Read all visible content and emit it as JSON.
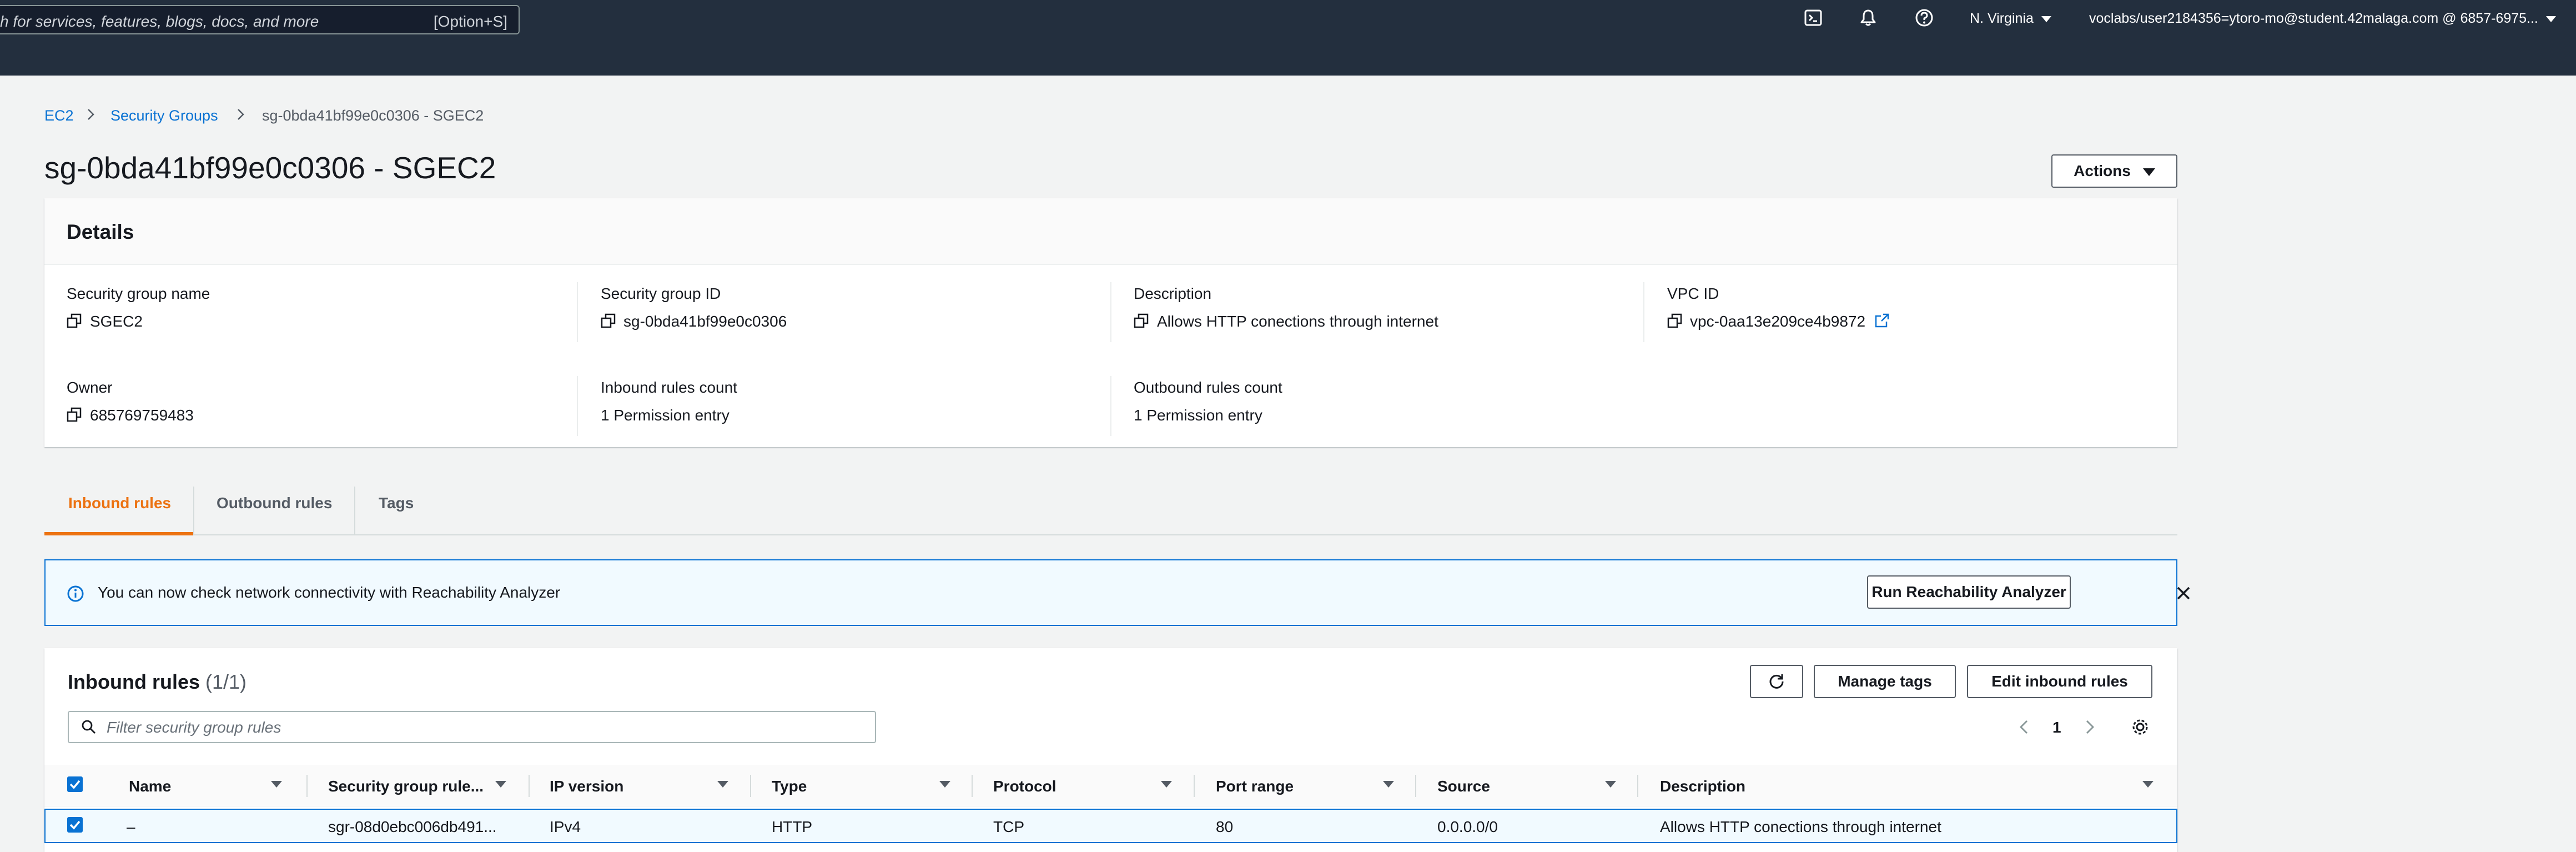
{
  "topnav": {
    "search_placeholder": "h for services, features, blogs, docs, and more",
    "search_shortcut": "[Option+S]",
    "region": "N. Virginia",
    "account": "voclabs/user2184356=ytoro-mo@student.42malaga.com @ 6857-6975..."
  },
  "breadcrumb": [
    "EC2",
    "Security Groups",
    "sg-0bda41bf99e0c0306 - SGEC2"
  ],
  "page_title": "sg-0bda41bf99e0c0306 - SGEC2",
  "actions_label": "Actions",
  "details": {
    "title": "Details",
    "fields": [
      {
        "label": "Security group name",
        "value": "SGEC2"
      },
      {
        "label": "Security group ID",
        "value": "sg-0bda41bf99e0c0306"
      },
      {
        "label": "Description",
        "value": "Allows HTTP conections through internet"
      },
      {
        "label": "VPC ID",
        "value": "vpc-0aa13e209ce4b9872"
      },
      {
        "label": "Owner",
        "value": "685769759483"
      },
      {
        "label": "Inbound rules count",
        "value": "1 Permission entry"
      },
      {
        "label": "Outbound rules count",
        "value": "1 Permission entry"
      }
    ]
  },
  "tabs": [
    "Inbound rules",
    "Outbound rules",
    "Tags"
  ],
  "banner": {
    "text": "You can now check network connectivity with Reachability Analyzer",
    "button": "Run Reachability Analyzer"
  },
  "rules": {
    "title": "Inbound rules",
    "count": "(1/1)",
    "manage_tags": "Manage tags",
    "edit_rules": "Edit inbound rules",
    "filter_placeholder": "Filter security group rules",
    "page": "1",
    "columns": [
      "Name",
      "Security group rule...",
      "IP version",
      "Type",
      "Protocol",
      "Port range",
      "Source",
      "Description"
    ],
    "rows": [
      {
        "name": "–",
        "rule_id": "sgr-08d0ebc006db491...",
        "ip_version": "IPv4",
        "type": "HTTP",
        "protocol": "TCP",
        "port_range": "80",
        "source": "0.0.0.0/0",
        "description": "Allows HTTP conections through internet"
      }
    ]
  },
  "colors": {
    "accent": "#ec7211",
    "link": "#0972d3",
    "nav_bg": "#232f3e"
  }
}
